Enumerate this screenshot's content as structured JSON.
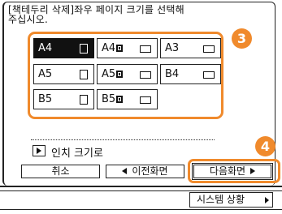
{
  "instruction": "[책테두리 삭제]좌우 페이지 크기를 선택해\n주십시오.",
  "paper_sizes": [
    {
      "label": "A4",
      "icon": "portrait-icon",
      "selected": true,
      "r": false
    },
    {
      "label": "A4",
      "icon": "landscape-icon",
      "selected": false,
      "r": true
    },
    {
      "label": "A3",
      "icon": "landscape-icon",
      "selected": false,
      "r": false
    },
    {
      "label": "A5",
      "icon": "portrait-icon",
      "selected": false,
      "r": false
    },
    {
      "label": "A5",
      "icon": "landscape-icon",
      "selected": false,
      "r": true
    },
    {
      "label": "B4",
      "icon": "landscape-icon",
      "selected": false,
      "r": false
    },
    {
      "label": "B5",
      "icon": "portrait-icon",
      "selected": false,
      "r": false
    },
    {
      "label": "B5",
      "icon": "landscape-icon",
      "selected": false,
      "r": true
    }
  ],
  "inch_size_label": "인치 크기로",
  "buttons": {
    "cancel": "취소",
    "previous": "이전화면",
    "next": "다음화면",
    "system_status": "시스템 상황"
  },
  "callouts": {
    "step3": "3",
    "step4": "4"
  },
  "colors": {
    "callout": "#f08a2c",
    "selected_bg": "#111111"
  }
}
